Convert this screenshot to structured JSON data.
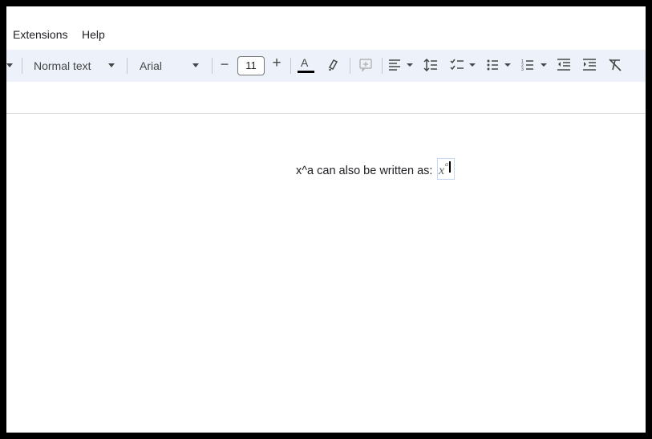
{
  "menubar": {
    "items": [
      {
        "label": "Extensions"
      },
      {
        "label": "Help"
      }
    ]
  },
  "toolbar": {
    "style_dropdown": "Normal text",
    "font_dropdown": "Arial",
    "decrease_font_size": "−",
    "font_size": "11",
    "increase_font_size": "+",
    "text_color_label": "A",
    "icons": [
      "chevron-down-icon",
      "highlighter-icon",
      "add-comment-icon",
      "align-left-icon",
      "line-spacing-icon",
      "checklist-icon",
      "bulleted-list-icon",
      "numbered-list-icon",
      "decrease-indent-icon",
      "increase-indent-icon",
      "clear-formatting-icon"
    ]
  },
  "document": {
    "text": "x^a can also be written as:",
    "equation": {
      "base": "x",
      "superscript": "a"
    }
  },
  "colors": {
    "toolbar_bg": "#edf2fa",
    "text_color_bar": "#000000",
    "equation_border": "#c6d7f7"
  }
}
